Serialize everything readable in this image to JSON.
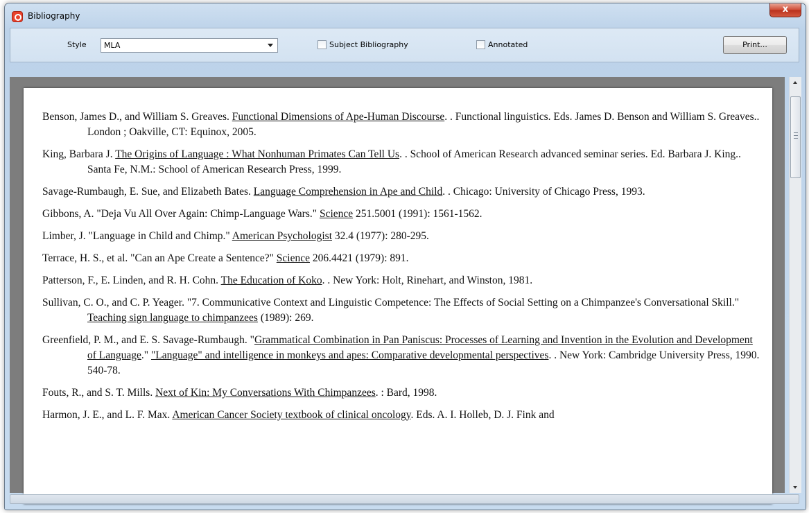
{
  "window": {
    "title": "Bibliography",
    "close_label": "x"
  },
  "toolbar": {
    "style_label": "Style",
    "style_value": "MLA",
    "subject_label": "Subject Bibliography",
    "subject_checked": false,
    "annotated_label": "Annotated",
    "annotated_checked": false,
    "print_label": "Print..."
  },
  "entries": [
    [
      {
        "t": "Benson, James D., and William S. Greaves. "
      },
      {
        "t": "Functional Dimensions of Ape-Human Discourse",
        "u": true
      },
      {
        "t": ". . Functional linguistics. Eds. James D. Benson and William S. Greaves.. London ; Oakville, CT: Equinox, 2005."
      }
    ],
    [
      {
        "t": "King, Barbara J. "
      },
      {
        "t": "The Origins of Language : What Nonhuman Primates Can Tell Us",
        "u": true
      },
      {
        "t": ". . School of American Research advanced seminar series. Ed. Barbara J. King.. Santa Fe, N.M.: School of American Research Press, 1999."
      }
    ],
    [
      {
        "t": "Savage-Rumbaugh, E. Sue, and Elizabeth Bates. "
      },
      {
        "t": "Language Comprehension in Ape and Child",
        "u": true
      },
      {
        "t": ". . Chicago: University of Chicago Press, 1993."
      }
    ],
    [
      {
        "t": "Gibbons, A. \"Deja Vu All Over Again: Chimp-Language Wars.\" "
      },
      {
        "t": "Science",
        "u": true
      },
      {
        "t": " 251.5001 (1991): 1561-1562."
      }
    ],
    [
      {
        "t": "Limber, J. \"Language in Child and Chimp.\" "
      },
      {
        "t": "American Psychologist",
        "u": true
      },
      {
        "t": " 32.4 (1977): 280-295."
      }
    ],
    [
      {
        "t": "Terrace, H. S., et al. \"Can an Ape Create a Sentence?\" "
      },
      {
        "t": "Science",
        "u": true
      },
      {
        "t": " 206.4421 (1979): 891."
      }
    ],
    [
      {
        "t": "Patterson, F., E. Linden, and R. H. Cohn. "
      },
      {
        "t": "The Education of Koko",
        "u": true
      },
      {
        "t": ". . New York: Holt, Rinehart, and Winston, 1981."
      }
    ],
    [
      {
        "t": "Sullivan, C. O., and C. P. Yeager. \"7. Communicative Context and Linguistic Competence: The Effects of Social Setting on a Chimpanzee's Conversational Skill.\" "
      },
      {
        "t": "Teaching sign language to chimpanzees",
        "u": true
      },
      {
        "t": " (1989): 269."
      }
    ],
    [
      {
        "t": "Greenfield, P. M., and E. S. Savage-Rumbaugh. \""
      },
      {
        "t": "Grammatical Combination in Pan Paniscus: Processes of Learning and Invention in the Evolution and Development of Language",
        "u": true
      },
      {
        "t": ".\" "
      },
      {
        "t": "\"Language\" and intelligence in monkeys and apes: Comparative developmental perspectives",
        "u": true
      },
      {
        "t": ". . New York: Cambridge University Press, 1990. 540-78."
      }
    ],
    [
      {
        "t": "Fouts, R., and S. T. Mills. "
      },
      {
        "t": "Next of Kin: My Conversations With Chimpanzees",
        "u": true
      },
      {
        "t": ". : Bard, 1998."
      }
    ],
    [
      {
        "t": "Harmon, J. E., and L. F. Max. "
      },
      {
        "t": "American Cancer Society textbook of clinical oncology",
        "u": true
      },
      {
        "t": ". Eds. A. I. Holleb, D. J. Fink and"
      }
    ]
  ]
}
